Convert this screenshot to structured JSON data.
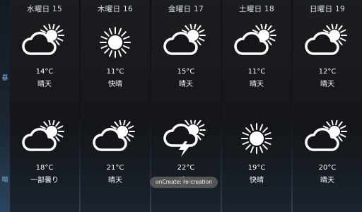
{
  "edge": {
    "glyph_top": "暴",
    "glyph_bottom": "喘"
  },
  "days": [
    {
      "title": "水曜日 15",
      "top": {
        "icon": "partly-cloudy-icon",
        "temp": "14°C",
        "cond": "晴天"
      },
      "bottom": {
        "icon": "partly-cloudy-icon",
        "temp": "18°C",
        "cond": "一部曇り"
      }
    },
    {
      "title": "木曜日 16",
      "top": {
        "icon": "sun-icon",
        "temp": "11°C",
        "cond": "快晴"
      },
      "bottom": {
        "icon": "partly-cloudy-icon",
        "temp": "21°C",
        "cond": "晴天"
      }
    },
    {
      "title": "金曜日 17",
      "top": {
        "icon": "partly-cloudy-icon",
        "temp": "15°C",
        "cond": "晴天"
      },
      "bottom": {
        "icon": "thunderstorm-sun-icon",
        "temp": "22°C",
        "cond": "晴天"
      }
    },
    {
      "title": "土曜日 18",
      "top": {
        "icon": "partly-cloudy-icon",
        "temp": "11°C",
        "cond": "晴天"
      },
      "bottom": {
        "icon": "sun-icon",
        "temp": "19°C",
        "cond": "快晴"
      }
    },
    {
      "title": "日曜日 19",
      "top": {
        "icon": "partly-cloudy-icon",
        "temp": "12°C",
        "cond": "晴天"
      },
      "bottom": {
        "icon": "partly-cloudy-icon",
        "temp": "20°C",
        "cond": "晴天"
      }
    }
  ],
  "toast": {
    "text": "onCreate: re-creation"
  }
}
